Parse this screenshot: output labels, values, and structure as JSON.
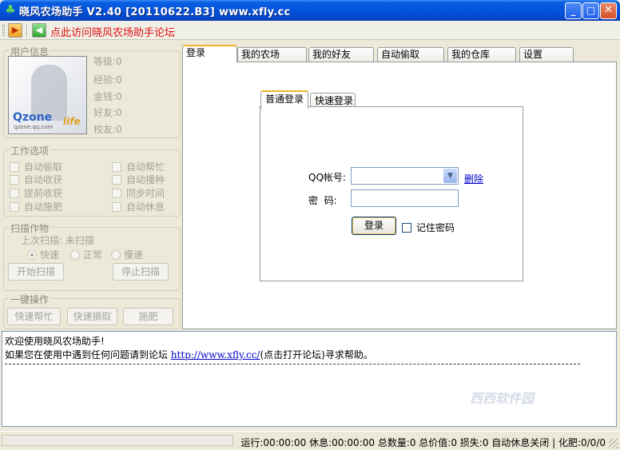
{
  "window": {
    "title": "晓风农场助手  V2.40 [20110622.B3]   www.xfly.cc",
    "min_label": "_",
    "max_label": "□",
    "close_label": "✕"
  },
  "toolbar": {
    "play_icon": "▶",
    "sound_icon": "◀",
    "forum_link": "点此访问晓风农场助手论坛"
  },
  "user_info": {
    "title": "用户信息",
    "avatar": {
      "brand": "Qzone",
      "sub": "qzone.qq.com",
      "tag": "life"
    },
    "stats": [
      "等级:0",
      "经验:0",
      "金钱:0",
      "好友:0",
      "校友:0"
    ]
  },
  "work_options": {
    "title": "工作选项",
    "left": [
      "自动偷取",
      "自动收获",
      "提前收获",
      "自动施肥"
    ],
    "right": [
      "自动帮忙",
      "自动播种",
      "同步时间",
      "自动休息"
    ]
  },
  "scan": {
    "title": "扫描作物",
    "last_scan": "上次扫描: 未扫描",
    "speeds": [
      "快速",
      "正常",
      "慢速"
    ],
    "selected_speed": "快速",
    "start_button": "开始扫描",
    "stop_button": "停止扫描"
  },
  "quick_ops": {
    "title": "一键操作",
    "buttons": [
      "快速帮忙",
      "快速摘取",
      "施肥"
    ]
  },
  "tabs": [
    {
      "label": "登录",
      "active": true
    },
    {
      "label": "我的农场",
      "active": false
    },
    {
      "label": "我的好友",
      "active": false
    },
    {
      "label": "自动偷取",
      "active": false
    },
    {
      "label": "我的仓库",
      "active": false
    },
    {
      "label": "设置",
      "active": false
    }
  ],
  "login": {
    "subtabs": [
      "普通登录",
      "快速登录"
    ],
    "qq_label": "QQ帐号:",
    "qq_value": "",
    "delete_link": "删除",
    "password_label": "密  码:",
    "password_value": "",
    "login_button": "登录",
    "remember_label": "记住密码"
  },
  "log": {
    "line1": "欢迎使用晓风农场助手!",
    "line2_prefix": "如果您在使用中遇到任何问题请到论坛 ",
    "line2_link": "http://www.xfly.cc/",
    "line2_suffix": "(点击打开论坛)寻求帮助。",
    "watermark": "西西软件园"
  },
  "status": {
    "text": "运行:00:00:00 休息:00:00:00 总数量:0 总价值:0 损失:0 自动休息关闭 | 化肥:0/0/0"
  }
}
